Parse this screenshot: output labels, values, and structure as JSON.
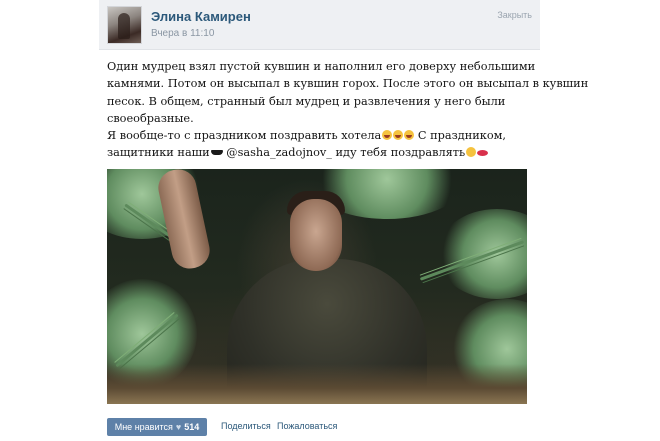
{
  "notification": {
    "author": "Элина Камирен",
    "time": "Вчера в 11:10",
    "close_label": "Закрыть"
  },
  "post": {
    "lines": [
      "Один мудрец взял пустой кувшин и наполнил его доверху небольшими",
      "камнями. Потом он высыпал в кувшин горох. После этого он высыпал в кувшин",
      "песок. В общем, странный был мудрец и развлечения у него были",
      "своеобразные."
    ],
    "line5_before": "Я вообще-то с праздником поздравить хотела",
    "line5_after": " С праздником,",
    "line6_before": "защитники наши",
    "line6_middle": " @sasha_zadojnov_ иду тебя поздравлять",
    "icons": {
      "laugh": "laughing-tears-emoji",
      "shades": "sunglasses-emoji",
      "wink": "winking-tongue-emoji",
      "kiss": "kiss-lips-emoji"
    }
  },
  "actions": {
    "like_label": "Мне нравится",
    "like_count": "514",
    "share_label": "Поделиться",
    "report_label": "Пожаловаться"
  },
  "colors": {
    "link": "#2b587a",
    "like_button": "#5e81a8",
    "header_bg": "#eef0f3"
  }
}
